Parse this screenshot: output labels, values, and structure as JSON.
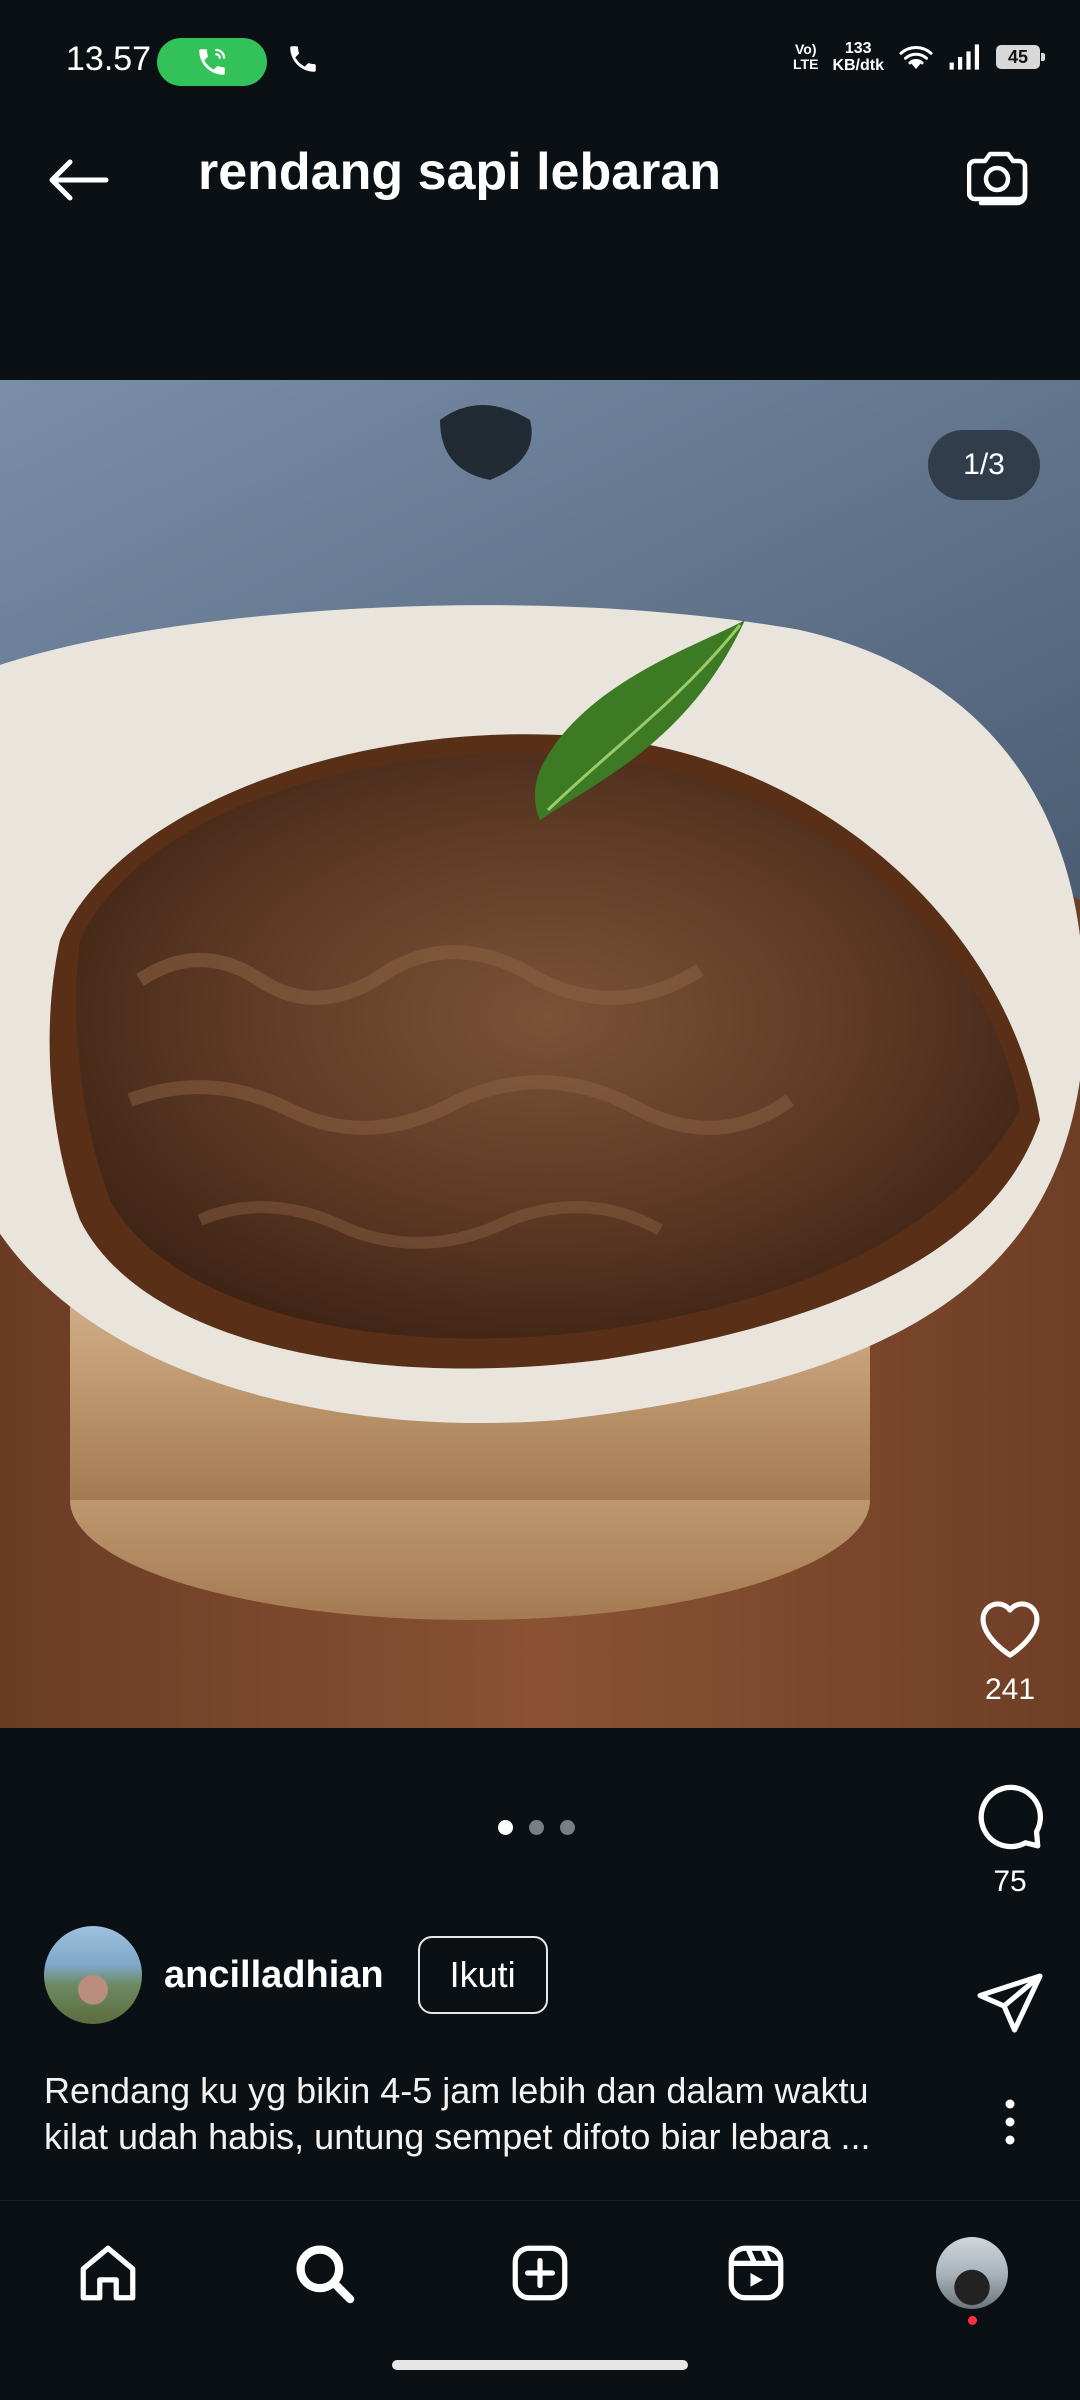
{
  "status_bar": {
    "time": "13.57",
    "network_label_top": "Vo)",
    "network_label_bottom": "LTE",
    "speed_value": "133",
    "speed_unit": "KB/dtk",
    "battery": "45"
  },
  "header": {
    "title": "rendang sapi lebaran"
  },
  "post": {
    "image_counter": "1/3",
    "likes": "241",
    "comments": "75",
    "slide_count": 3,
    "active_slide": 1
  },
  "author": {
    "username": "ancilladhian",
    "follow_label": "Ikuti"
  },
  "caption": {
    "line1": "Rendang ku yg bikin 4-5 jam lebih dan dalam waktu",
    "line2": "kilat udah habis, untung sempet difoto biar lebara ..."
  },
  "colors": {
    "background": "#0b1014",
    "call_pill": "#33c15a",
    "notification_dot": "#ff3040"
  },
  "icons": {
    "header_back": "arrow-left-icon",
    "header_camera": "camera-icon",
    "like": "heart-icon",
    "comment": "comment-bubble-icon",
    "share": "send-icon",
    "more": "more-vertical-icon",
    "nav": [
      "home-icon",
      "search-icon",
      "add-post-icon",
      "reels-icon",
      "profile-avatar"
    ]
  }
}
